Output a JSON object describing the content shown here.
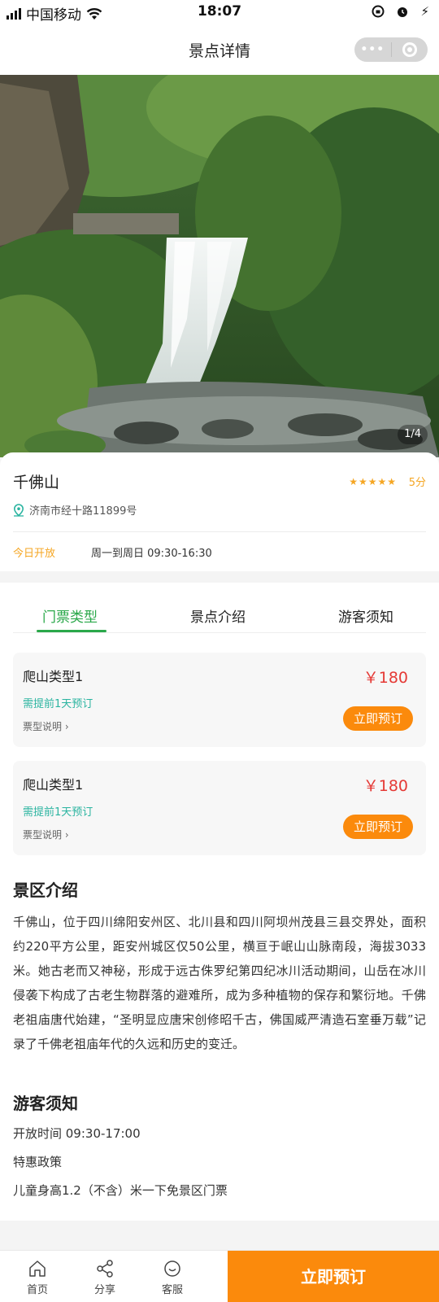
{
  "status_bar": {
    "carrier": "中国移动",
    "time": "18:07",
    "charge": "⚡"
  },
  "nav": {
    "title": "景点详情",
    "more_dots": "•••"
  },
  "gallery": {
    "indicator": "1/4"
  },
  "spot": {
    "name": "千佛山",
    "stars": "★★★★★",
    "rating": 5,
    "score_label": "5分",
    "address": "济南市经十路11899号",
    "open_label": "今日开放",
    "open_hours": "周一到周日 09:30-16:30"
  },
  "tabs": [
    {
      "label": "门票类型",
      "active": true
    },
    {
      "label": "景点介绍",
      "active": false
    },
    {
      "label": "游客须知",
      "active": false
    }
  ],
  "tickets": [
    {
      "name": "爬山类型1",
      "price": "￥180",
      "note": "需提前1天预订",
      "desc": "票型说明 ›",
      "button": "立即预订"
    },
    {
      "name": "爬山类型1",
      "price": "￥180",
      "note": "需提前1天预订",
      "desc": "票型说明 ›",
      "button": "立即预订"
    }
  ],
  "intro": {
    "title": "景区介绍",
    "text": "千佛山，位于四川绵阳安州区、北川县和四川阿坝州茂县三县交界处，面积约220平方公里，距安州城区仅50公里，横亘于岷山山脉南段，海拔3033米。她古老而又神秘，形成于远古侏罗纪第四纪冰川活动期间，山岳在冰川侵袭下构成了古老生物群落的避难所，成为多种植物的保存和繁衍地。千佛老祖庙唐代始建，“圣明显应唐宋创修昭千古，佛国威严清造石室垂万载”记录了千佛老祖庙年代的久远和历史的变迁。"
  },
  "notice": {
    "title": "游客须知",
    "lines": [
      "开放时间 09:30-17:00",
      "特惠政策",
      "儿童身高1.2（不含）米一下免景区门票"
    ]
  },
  "bottom_bar": {
    "home": "首页",
    "share": "分享",
    "service": "客服",
    "book": "立即预订"
  },
  "colors": {
    "accent_orange": "#fb8a0c",
    "tab_green": "#2aa84a",
    "price_red": "#e53935",
    "note_teal": "#2ab4a0",
    "rating_orange": "#f5a623"
  }
}
